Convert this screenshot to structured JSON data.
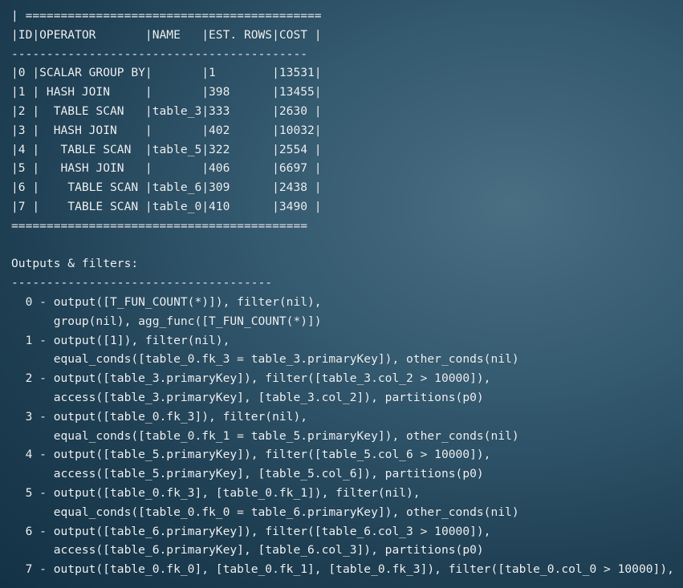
{
  "plan_table": {
    "top_border": "| ==========================================",
    "header": "|ID|OPERATOR       |NAME   |EST. ROWS|COST |",
    "separator": "------------------------------------------",
    "rows": [
      "|0 |SCALAR GROUP BY|       |1        |13531|",
      "|1 | HASH JOIN     |       |398      |13455|",
      "|2 |  TABLE SCAN   |table_3|333      |2630 |",
      "|3 |  HASH JOIN    |       |402      |10032|",
      "|4 |   TABLE SCAN  |table_5|322      |2554 |",
      "|5 |   HASH JOIN   |       |406      |6697 |",
      "|6 |    TABLE SCAN |table_6|309      |2438 |",
      "|7 |    TABLE SCAN |table_0|410      |3490 |"
    ],
    "bottom_border": "=========================================="
  },
  "outputs": {
    "title": "Outputs & filters:",
    "separator": "-------------------------------------",
    "lines": [
      "  0 - output([T_FUN_COUNT(*)]), filter(nil),",
      "      group(nil), agg_func([T_FUN_COUNT(*)])",
      "  1 - output([1]), filter(nil),",
      "      equal_conds([table_0.fk_3 = table_3.primaryKey]), other_conds(nil)",
      "  2 - output([table_3.primaryKey]), filter([table_3.col_2 > 10000]),",
      "      access([table_3.primaryKey], [table_3.col_2]), partitions(p0)",
      "  3 - output([table_0.fk_3]), filter(nil),",
      "      equal_conds([table_0.fk_1 = table_5.primaryKey]), other_conds(nil)",
      "  4 - output([table_5.primaryKey]), filter([table_5.col_6 > 10000]),",
      "      access([table_5.primaryKey], [table_5.col_6]), partitions(p0)",
      "  5 - output([table_0.fk_3], [table_0.fk_1]), filter(nil),",
      "      equal_conds([table_0.fk_0 = table_6.primaryKey]), other_conds(nil)",
      "  6 - output([table_6.primaryKey]), filter([table_6.col_3 > 10000]),",
      "      access([table_6.primaryKey], [table_6.col_3]), partitions(p0)",
      "  7 - output([table_0.fk_0], [table_0.fk_1], [table_0.fk_3]), filter([table_0.col_0 > 10000]),"
    ]
  }
}
